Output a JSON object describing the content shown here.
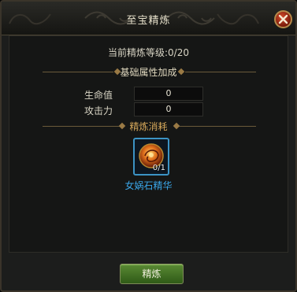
{
  "dialog": {
    "title": "至宝精炼",
    "close_icon": "close-icon"
  },
  "level": {
    "text": "当前精炼等级:0/20"
  },
  "attributes": {
    "section_label": "基础属性加成",
    "items": [
      {
        "name": "生命值",
        "value": "0"
      },
      {
        "name": "攻击力",
        "value": "0"
      }
    ]
  },
  "refine_cost": {
    "section_label": "精炼消耗",
    "item": {
      "icon": "stone-icon",
      "count": "0/1",
      "name": "女娲石精华"
    }
  },
  "actions": {
    "refine_label": "精炼"
  },
  "colors": {
    "item_name": "#3aa6e8",
    "section_refine": "#d6a85a",
    "button": "#4a7a28"
  }
}
